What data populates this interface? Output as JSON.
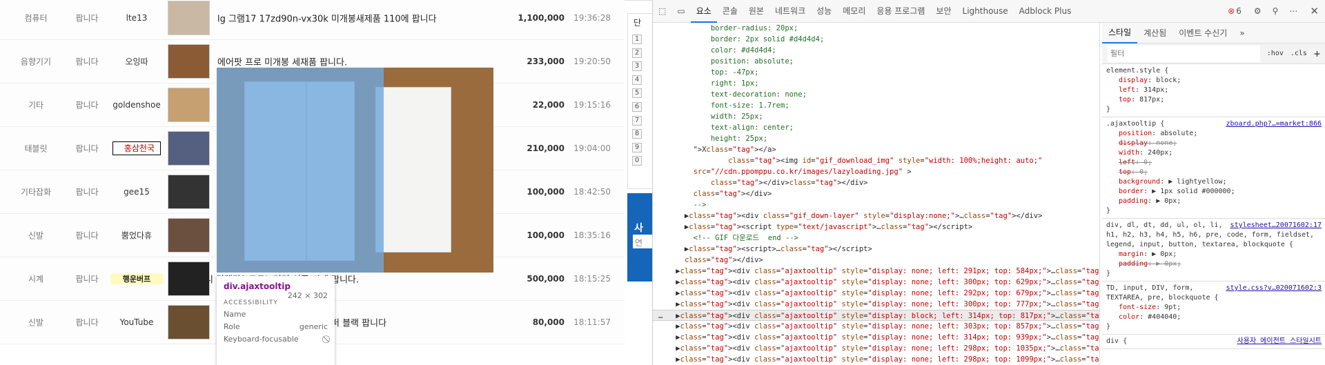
{
  "listing": [
    {
      "category": "컴퓨터",
      "type": "팝니다",
      "author": "lte13",
      "title": "lg 그램17 17zd90n-vx30k 미개봉새제품 110에 팝니다",
      "price": "1,100,000",
      "time": "19:36:28"
    },
    {
      "category": "음향기기",
      "type": "팝니다",
      "author": "오잉따",
      "title": "에어팟 프로 미개봉 세재품 팝니다.",
      "price": "233,000",
      "time": "19:20:50"
    },
    {
      "category": "기타",
      "type": "팝니다",
      "author": "goldenshoe",
      "title": "",
      "price": "22,000",
      "time": "19:15:16"
    },
    {
      "category": "태블릿",
      "type": "팝니다",
      "author": "홍삼천국",
      "title": "",
      "price": "210,000",
      "time": "19:04:00"
    },
    {
      "category": "기타잡화",
      "type": "팝니다",
      "author": "gee15",
      "title": "",
      "price": "100,000",
      "time": "18:42:50"
    },
    {
      "category": "신발",
      "type": "팝니다",
      "author": "뿜었다휴",
      "title": "",
      "price": "100,000",
      "time": "18:35:16"
    },
    {
      "category": "시계",
      "type": "팝니다",
      "author": "행운버프",
      "title": "미니 킹맥단? 크로노미터 이중 시계 팝니다.",
      "price": "500,000",
      "time": "18:15:25"
    },
    {
      "category": "신발",
      "type": "팝니다",
      "author": "YouTube",
      "title": "퍼 블랙 팝니다",
      "price": "80,000",
      "time": "18:11:57"
    }
  ],
  "side": {
    "label": "단",
    "numbers": [
      "1",
      "2",
      "3",
      "4",
      "5",
      "6",
      "7",
      "8",
      "9",
      "0"
    ],
    "blue_label": "사",
    "input": "연"
  },
  "inspector": {
    "tag": "div.ajaxtooltip",
    "size": "242 × 302",
    "section": "ACCESSIBILITY",
    "rows": [
      [
        "Name",
        ""
      ],
      [
        "Role",
        "generic"
      ],
      [
        "Keyboard-focusable",
        "⃠"
      ]
    ]
  },
  "devtools": {
    "tabs": [
      "요소",
      "콘솔",
      "원본",
      "네트워크",
      "성능",
      "메모리",
      "응용 프로그램",
      "보안",
      "Lighthouse",
      "Adblock Plus"
    ],
    "errors": "6",
    "code": [
      "            border-radius: 20px;",
      "            border: 2px solid #d4d4d4;",
      "            color: #d4d4d4;",
      "            position: absolute;",
      "            top: -47px;",
      "            right: 1px;",
      "            text-decoration: none;",
      "            font-size: 1.7rem;",
      "            width: 25px;",
      "            text-align: center;",
      "            height: 25px;",
      "        \">X</a>",
      "                <img id=\"gif_download_img\" style=\"width: 100%;height: auto;\"",
      "        src=\"//cdn.ppomppu.co.kr/images/lazyloading.jpg\" >",
      "            </div></div>",
      "        </div>",
      "        -->",
      "      ▶<div class=\"gif_down-layer\" style=\"display:none;\">…</div>",
      "      ▶<script type=\"text/javascript\">…</script>",
      "        <!-- GIF 다운로드  end -->",
      "      ▶<script>…</script>",
      "      </div>",
      "    ▶<div class=\"ajaxtooltip\" style=\"display: none; left: 291px; top: 584px;\">…</div>",
      "    ▶<div class=\"ajaxtooltip\" style=\"display: none; left: 300px; top: 629px;\">…</div>",
      "    ▶<div class=\"ajaxtooltip\" style=\"display: none; left: 292px; top: 679px;\">…</div>",
      "    ▶<div class=\"ajaxtooltip\" style=\"display: none; left: 300px; top: 777px;\">…</div>",
      "…   ▶<div class=\"ajaxtooltip\" style=\"display: block; left: 314px; top: 817px;\">…</div> == $0",
      "    ▶<div class=\"ajaxtooltip\" style=\"display: none; left: 303px; top: 857px;\">…</div>",
      "    ▶<div class=\"ajaxtooltip\" style=\"display: none; left: 314px; top: 939px;\">…</div>",
      "    ▶<div class=\"ajaxtooltip\" style=\"display: none; left: 298px; top: 1035px;\">…</div>",
      "    ▶<div class=\"ajaxtooltip\" style=\"display: none; left: 298px; top: 1099px;\">…</div>"
    ],
    "selected_line": 26,
    "styles_tabs": [
      "스타일",
      "계산됨",
      "이벤트 수신기",
      "»"
    ],
    "filter_placeholder": "필터",
    "hov": ":hov",
    "cls": ".cls",
    "plus": "+",
    "rules": [
      {
        "selector": "element.style {",
        "source": "",
        "props": [
          [
            "display",
            "block",
            false
          ],
          [
            "left",
            "314px",
            false
          ],
          [
            "top",
            "817px",
            false
          ]
        ]
      },
      {
        "selector": ".ajaxtooltip {",
        "source": "zboard.php?…=market:866",
        "props": [
          [
            "position",
            "absolute",
            false
          ],
          [
            "display",
            "none",
            true
          ],
          [
            "width",
            "240px",
            false
          ],
          [
            "left",
            "0",
            true
          ],
          [
            "top",
            "0",
            true
          ],
          [
            "background",
            "▶ lightyellow",
            false
          ],
          [
            "border",
            "▶ 1px solid #000000",
            false
          ],
          [
            "padding",
            "▶ 0px",
            false
          ]
        ]
      },
      {
        "selector": "div, dl, dt, dd, ul, ol, li, h1, h2, h3, h4, h5, h6, pre, code, form, fieldset, legend, input, button, textarea, blockquote {",
        "source": "stylesheet…20071602:17",
        "props": [
          [
            "margin",
            "▶ 0px",
            false
          ],
          [
            "padding",
            "▶ 0px",
            true
          ]
        ]
      },
      {
        "selector": "TD, input, DIV, form, TEXTAREA, pre, blockquote {",
        "source": "style.css?v…020071602:3",
        "props": [
          [
            "font-size",
            "9pt",
            false
          ],
          [
            "color",
            "#404040",
            false
          ]
        ]
      },
      {
        "selector": "div {",
        "source": "사용자 에이전트 스타일시트",
        "props": []
      }
    ]
  }
}
